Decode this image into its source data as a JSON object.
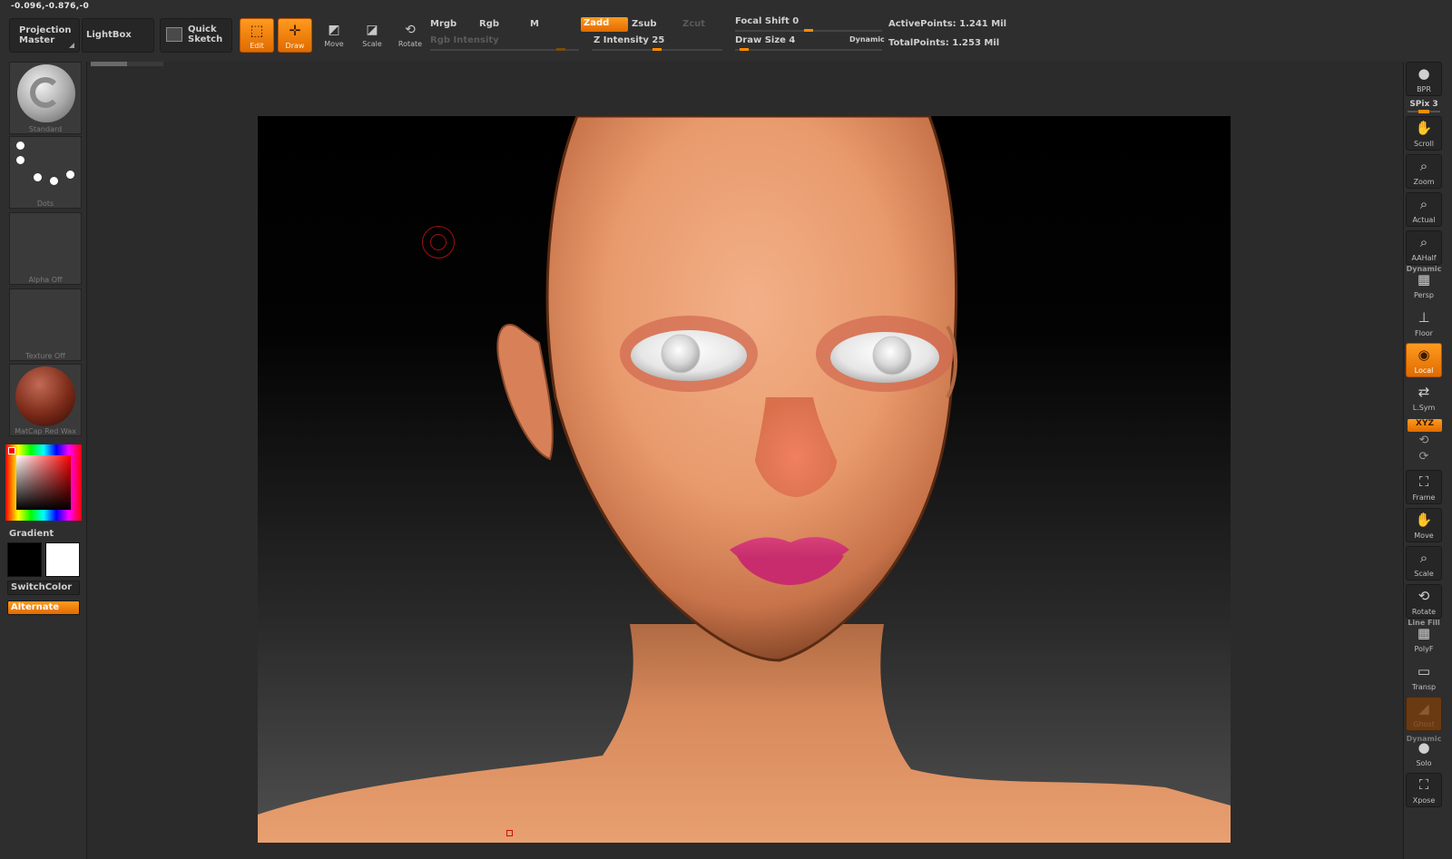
{
  "status": {
    "coordinates": "-0.096,-0.876,-0"
  },
  "toolbar": {
    "projection_master": [
      "Projection",
      "Master"
    ],
    "lightbox": "LightBox",
    "quick_sketch": [
      "Quick",
      "Sketch"
    ],
    "edit": "Edit",
    "draw": "Draw",
    "move": "Move",
    "scale": "Scale",
    "rotate": "Rotate",
    "mrgb": "Mrgb",
    "rgb": "Rgb",
    "m": "M",
    "zadd": "Zadd",
    "zsub": "Zsub",
    "zcut": "Zcut",
    "rgb_intensity": "Rgb  Intensity",
    "z_intensity": "Z Intensity 25",
    "focal_shift": "Focal Shift 0",
    "draw_size": "Draw Size 4",
    "dynamic": "Dynamic",
    "active_points": "ActivePoints: 1.241  Mil",
    "total_points": "TotalPoints: 1.253  Mil"
  },
  "left_panel": {
    "brush": "Standard",
    "stroke": "Dots",
    "alpha": "Alpha  Off",
    "texture": "Texture  Off",
    "material": "MatCap  Red  Wax",
    "gradient": "Gradient",
    "switch_color": "SwitchColor",
    "alternate": "Alternate",
    "main_color": "#000000",
    "secondary_color": "#ffffff"
  },
  "right_shelf": {
    "bpr": "BPR",
    "spix": "SPix 3",
    "scroll": "Scroll",
    "zoom": "Zoom",
    "actual": "Actual",
    "aahalf": "AAHalf",
    "dynamic": "Dynamic",
    "persp": "Persp",
    "floor": "Floor",
    "local": "Local",
    "lsym": "L.Sym",
    "xyz": "XYZ",
    "frame": "Frame",
    "move": "Move",
    "scale": "Scale",
    "rotate": "Rotate",
    "line_fill": "Line Fill",
    "polyf": "PolyF",
    "transp": "Transp",
    "ghost": "Ghost",
    "dynamic2": "Dynamic",
    "solo": "Solo",
    "xpose": "Xpose"
  },
  "sliders": {
    "rgb_intensity": 0.9,
    "z_intensity": 0.5,
    "focal_shift": 0.5,
    "draw_size": 0.03
  },
  "colors": {
    "accent": "#ff8a00",
    "panel": "#2e2e2e",
    "canvas_top": "#000000",
    "canvas_bottom": "#505050"
  }
}
